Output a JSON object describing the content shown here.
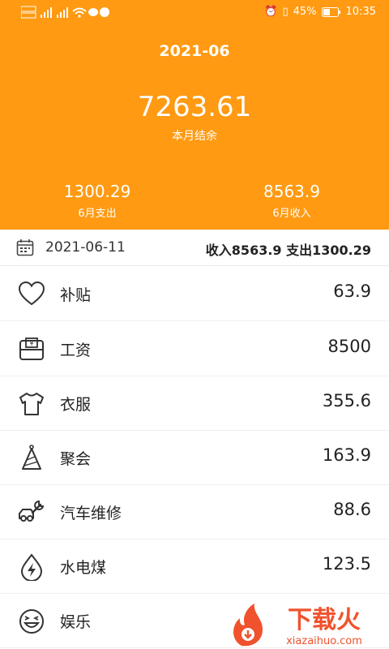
{
  "status_bar": {
    "battery": "45%",
    "time": "10:35"
  },
  "header": {
    "month": "2021-06",
    "balance": "7263.61",
    "balance_label": "本月结余",
    "expense_value": "1300.29",
    "expense_label": "6月支出",
    "income_value": "8563.9",
    "income_label": "6月收入",
    "bg_color": "#ff9a12"
  },
  "summary": {
    "date": "2021-06-11",
    "totals": "收入8563.9  支出1300.29",
    "icon": "calendar-icon"
  },
  "entries": [
    {
      "name": "补贴",
      "amount": "63.9",
      "icon": "heart-icon"
    },
    {
      "name": "工资",
      "amount": "8500",
      "icon": "salary-envelope-icon"
    },
    {
      "name": "衣服",
      "amount": "355.6",
      "icon": "shirt-icon"
    },
    {
      "name": "聚会",
      "amount": "163.9",
      "icon": "party-hat-icon"
    },
    {
      "name": "汽车维修",
      "amount": "88.6",
      "icon": "car-repair-icon"
    },
    {
      "name": "水电煤",
      "amount": "123.5",
      "icon": "utility-bolt-icon"
    },
    {
      "name": "娱乐",
      "amount": "",
      "icon": "laugh-face-icon"
    }
  ],
  "watermark": {
    "text_cn": "下载火",
    "text_en": "xiazaihuo.com"
  }
}
